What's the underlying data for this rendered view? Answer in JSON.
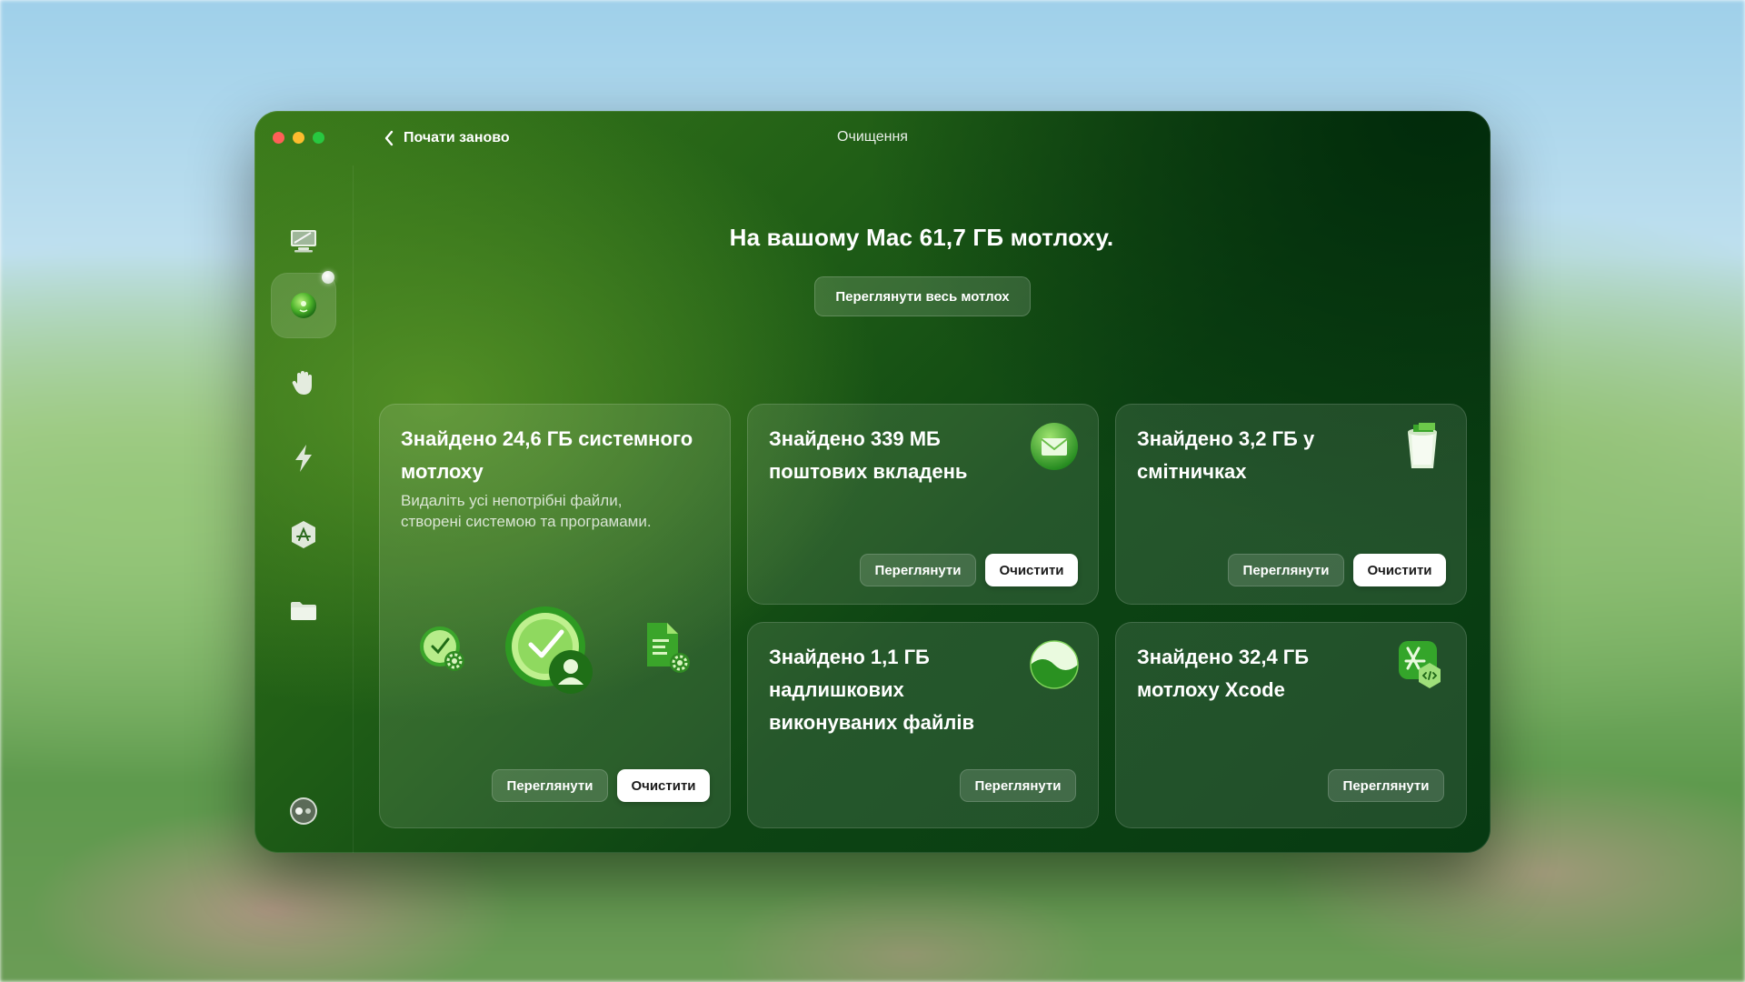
{
  "window": {
    "back_label": "Почати заново",
    "title": "Очищення"
  },
  "sidebar": {
    "items": [
      {
        "name": "system-junk",
        "icon": "monitor-sweep-icon"
      },
      {
        "name": "cleanup",
        "icon": "green-orb-icon",
        "active": true
      },
      {
        "name": "protection",
        "icon": "hand-icon"
      },
      {
        "name": "performance",
        "icon": "lightning-icon"
      },
      {
        "name": "applications",
        "icon": "app-store-icon"
      },
      {
        "name": "my-clutter",
        "icon": "folder-icon"
      },
      {
        "name": "assistant",
        "icon": "assistant-dots-icon"
      }
    ]
  },
  "main": {
    "headline": "На вашому Mac 61,7 ГБ мотлоху.",
    "review_all_label": "Переглянути весь мотлох"
  },
  "cards": [
    {
      "id": "system-junk",
      "title_line1": "Знайдено 24,6 ГБ системного",
      "title_line2": "мотлоху",
      "desc_line1": "Видаліть усі непотрібні файли,",
      "desc_line2": "створені системою та програмами.",
      "review_label": "Переглянути",
      "clean_label": "Очистити"
    },
    {
      "id": "mail-attachments",
      "title_line1": "Знайдено 339 МБ",
      "title_line2": "поштових вкладень",
      "icon": "mail-icon",
      "review_label": "Переглянути",
      "clean_label": "Очистити"
    },
    {
      "id": "trash-bins",
      "title_line1": "Знайдено 3,2 ГБ у",
      "title_line2": "смітничках",
      "icon": "trash-bin-icon",
      "review_label": "Переглянути",
      "clean_label": "Очистити"
    },
    {
      "id": "universal-binaries",
      "title_line1": "Знайдено 1,1 ГБ",
      "title_line2": "надлишкових",
      "title_line3": "виконуваних файлів",
      "icon": "binary-orb-icon",
      "review_label": "Переглянути"
    },
    {
      "id": "xcode-junk",
      "title_line1": "Знайдено 32,4 ГБ",
      "title_line2": "мотлоху Xcode",
      "icon": "xcode-icon",
      "review_label": "Переглянути"
    }
  ],
  "colors": {
    "accent_green": "#2f7d1f",
    "button_solid": "#ffffff",
    "traffic_close": "#ff5f57",
    "traffic_min": "#febc2e",
    "traffic_max": "#28c840"
  }
}
